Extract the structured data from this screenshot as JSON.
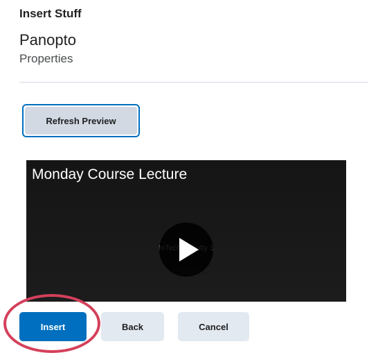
{
  "dialog": {
    "title": "Insert Stuff",
    "app_name": "Panopto",
    "subtitle": "Properties"
  },
  "toolbar": {
    "refresh_label": "Refresh Preview"
  },
  "video": {
    "title": "Monday Course Lecture",
    "watermark": "InTech Faculty 1",
    "play_icon": "play-icon"
  },
  "footer": {
    "insert_label": "Insert",
    "back_label": "Back",
    "cancel_label": "Cancel"
  },
  "colors": {
    "primary": "#006fbf",
    "annotation": "#d4405b",
    "secondary_button": "#e3e9f1"
  }
}
